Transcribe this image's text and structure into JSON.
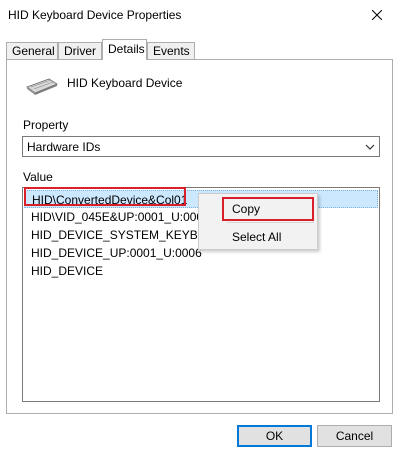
{
  "window": {
    "title": "HID Keyboard Device Properties",
    "close_icon": "close-icon"
  },
  "tabs": [
    {
      "label": "General"
    },
    {
      "label": "Driver"
    },
    {
      "label": "Details"
    },
    {
      "label": "Events"
    }
  ],
  "active_tab": "Details",
  "device": {
    "name": "HID Keyboard Device",
    "icon": "keyboard-icon"
  },
  "property": {
    "label": "Property",
    "selected": "Hardware IDs"
  },
  "value": {
    "label": "Value",
    "items": [
      "HID\\ConvertedDevice&Col01",
      "HID\\VID_045E&UP:0001_U:0006",
      "HID_DEVICE_SYSTEM_KEYBOARD",
      "HID_DEVICE_UP:0001_U:0006",
      "HID_DEVICE"
    ],
    "selected_index": 0
  },
  "context_menu": {
    "items": [
      "Copy",
      "Select All"
    ]
  },
  "buttons": {
    "ok": "OK",
    "cancel": "Cancel"
  },
  "colors": {
    "highlight": "#d9202a",
    "selection": "#cce8ff",
    "default_button_border": "#0078d7"
  }
}
